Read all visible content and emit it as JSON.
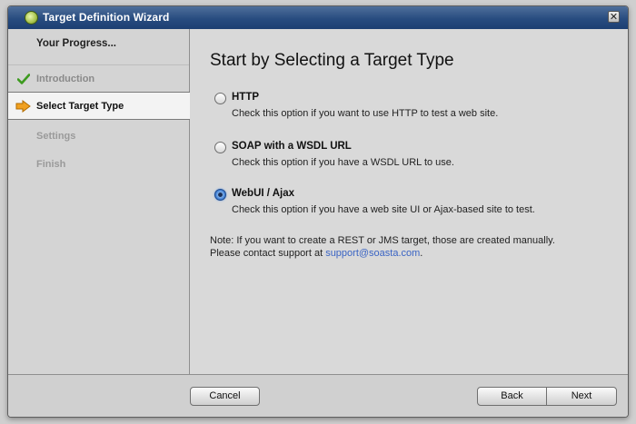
{
  "window": {
    "title": "Target Definition Wizard",
    "close_symbol": "✕"
  },
  "sidebar": {
    "progress_label": "Your Progress...",
    "steps": [
      {
        "label": "Introduction",
        "state": "done",
        "icon": "check-icon"
      },
      {
        "label": "Select Target Type",
        "state": "current",
        "icon": "arrow-right-icon"
      },
      {
        "label": "Settings",
        "state": "pending"
      },
      {
        "label": "Finish",
        "state": "pending"
      }
    ]
  },
  "main": {
    "heading": "Start by Selecting a Target Type",
    "options": [
      {
        "title": "HTTP",
        "description": "Check this option if you want to use HTTP to test a web site.",
        "selected": false
      },
      {
        "title": "SOAP with a WSDL URL",
        "description": "Check this option if you have a WSDL URL to use.",
        "selected": false
      },
      {
        "title": "WebUI / Ajax",
        "description": "Check this option if you have a web site UI or Ajax-based site to test.",
        "selected": true
      }
    ],
    "note_line1": "Note: If you want to create a REST or JMS target, those are created manually.",
    "note_line2_prefix": "Please contact support at ",
    "note_link": "support@soasta.com",
    "note_line2_suffix": "."
  },
  "footer": {
    "cancel_label": "Cancel",
    "back_label": "Back",
    "next_label": "Next"
  },
  "colors": {
    "titlebar": "#284c80",
    "link": "#3a64c4",
    "check_green": "#3c9a1e",
    "arrow_orange": "#f0a020"
  }
}
